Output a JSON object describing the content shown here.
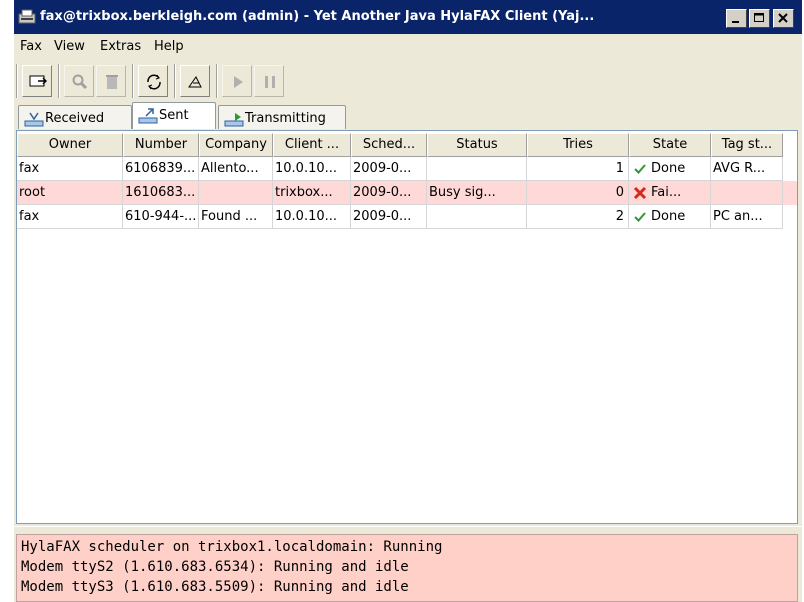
{
  "window": {
    "title": "fax@trixbox.berkleigh.com (admin) - Yet Another Java HylaFAX Client (Yaj..."
  },
  "menu": [
    "Fax",
    "View",
    "Extras",
    "Help"
  ],
  "toolbar": {
    "icons": [
      "send-fax-icon",
      "view-icon",
      "delete-icon",
      "refresh-icon",
      "resubmit-icon",
      "resume-icon",
      "suspend-icon"
    ]
  },
  "tabs": [
    {
      "label": "Received",
      "active": false
    },
    {
      "label": "Sent",
      "active": true
    },
    {
      "label": "Transmitting",
      "active": false
    }
  ],
  "table": {
    "columns": [
      "Owner",
      "Number",
      "Company",
      "Client ...",
      "Sched...",
      "Status",
      "Tries",
      "State",
      "Tag st..."
    ],
    "rows": [
      {
        "owner": "fax",
        "number": "6106839...",
        "company": "Allento...",
        "client": "10.0.10...",
        "sched": "2009-0...",
        "status": "",
        "tries": "1",
        "state": "Done",
        "state_icon": "check-icon",
        "tag": "AVG R...",
        "error": false
      },
      {
        "owner": "root",
        "number": "1610683...",
        "company": "",
        "client": "trixbox...",
        "sched": "2009-0...",
        "status": "Busy sig...",
        "tries": "0",
        "state": "Fai...",
        "state_icon": "error-x-icon",
        "tag": "",
        "error": true
      },
      {
        "owner": "fax",
        "number": "610-944-...",
        "company": "Found ...",
        "client": "10.0.10...",
        "sched": "2009-0...",
        "status": "",
        "tries": "2",
        "state": "Done",
        "state_icon": "check-icon",
        "tag": "PC an...",
        "error": false
      }
    ]
  },
  "status_lines": [
    "HylaFAX scheduler on trixbox1.localdomain: Running",
    "Modem ttyS2 (1.610.683.6534): Running and idle",
    "Modem ttyS3 (1.610.683.5509): Running and idle"
  ],
  "colors": {
    "titlebar": "#0a246a",
    "error_row": "#ffd8d8",
    "status_panel": "#ffd0c8",
    "check": "#2e9a2e",
    "error_x": "#d42a1a"
  }
}
